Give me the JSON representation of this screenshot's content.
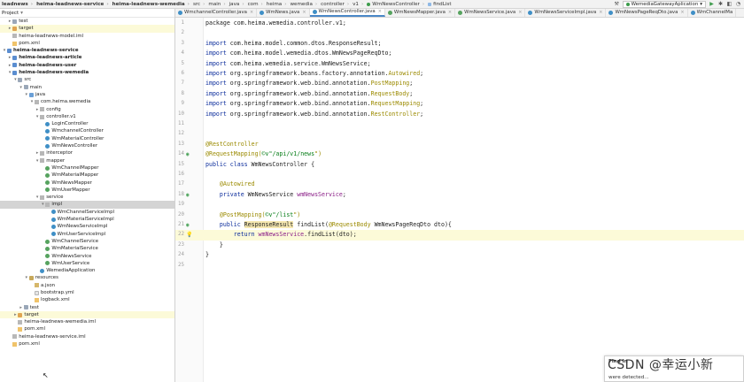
{
  "breadcrumb": {
    "items": [
      "leadnews",
      "heima-leadnews-service",
      "heima-leadnews-wemedia",
      "src",
      "main",
      "java",
      "com",
      "heima",
      "wemedia",
      "controller",
      "v1",
      "WmNewsController",
      "findList"
    ],
    "bold_count": 3
  },
  "toolbar": {
    "run_config": "WemediaGatewayAplication",
    "run_icon": "play-icon",
    "debug_icon": "bug-icon"
  },
  "project": {
    "title": "Project",
    "tree": [
      {
        "label": "test",
        "depth": 1,
        "kind": "folder",
        "arrow": "▸"
      },
      {
        "label": "target",
        "depth": 1,
        "kind": "folder-target",
        "arrow": "▸",
        "hl": true
      },
      {
        "label": "heima-leadnews-model.iml",
        "depth": 1,
        "kind": "iml"
      },
      {
        "label": "pom.xml",
        "depth": 1,
        "kind": "xml"
      },
      {
        "label": "heima-leadnews-service",
        "depth": 0,
        "kind": "module",
        "arrow": "▾",
        "bold": true
      },
      {
        "label": "heima-leadnews-article",
        "depth": 1,
        "kind": "module",
        "arrow": "▸",
        "bold": true
      },
      {
        "label": "heima-leadnews-user",
        "depth": 1,
        "kind": "module",
        "arrow": "▸",
        "bold": true
      },
      {
        "label": "heima-leadnews-wemedia",
        "depth": 1,
        "kind": "module",
        "arrow": "▾",
        "bold": true
      },
      {
        "label": "src",
        "depth": 2,
        "kind": "folder",
        "arrow": "▾"
      },
      {
        "label": "main",
        "depth": 3,
        "kind": "folder",
        "arrow": "▾"
      },
      {
        "label": "java",
        "depth": 4,
        "kind": "folder-src",
        "arrow": "▾"
      },
      {
        "label": "com.heima.wemedia",
        "depth": 5,
        "kind": "pkg",
        "arrow": "▾"
      },
      {
        "label": "config",
        "depth": 6,
        "kind": "pkg",
        "arrow": "▸"
      },
      {
        "label": "controller.v1",
        "depth": 6,
        "kind": "pkg",
        "arrow": "▾"
      },
      {
        "label": "LoginController",
        "depth": 7,
        "kind": "class"
      },
      {
        "label": "WmchannelController",
        "depth": 7,
        "kind": "class"
      },
      {
        "label": "WmMaterialController",
        "depth": 7,
        "kind": "class"
      },
      {
        "label": "WmNewsController",
        "depth": 7,
        "kind": "class"
      },
      {
        "label": "interceptor",
        "depth": 6,
        "kind": "pkg",
        "arrow": "▸"
      },
      {
        "label": "mapper",
        "depth": 6,
        "kind": "pkg",
        "arrow": "▾"
      },
      {
        "label": "WmChannelMapper",
        "depth": 7,
        "kind": "iface"
      },
      {
        "label": "WmMaterialMapper",
        "depth": 7,
        "kind": "iface"
      },
      {
        "label": "WmNewsMapper",
        "depth": 7,
        "kind": "iface"
      },
      {
        "label": "WmUserMapper",
        "depth": 7,
        "kind": "iface"
      },
      {
        "label": "service",
        "depth": 6,
        "kind": "pkg",
        "arrow": "▾"
      },
      {
        "label": "impl",
        "depth": 7,
        "kind": "pkg",
        "arrow": "▾",
        "sel": true
      },
      {
        "label": "WmChannelServiceImpl",
        "depth": 8,
        "kind": "class"
      },
      {
        "label": "WmMaterialServiceImpl",
        "depth": 8,
        "kind": "class"
      },
      {
        "label": "WmNewsServiceImpl",
        "depth": 8,
        "kind": "class"
      },
      {
        "label": "WmUserServiceImpl",
        "depth": 8,
        "kind": "class"
      },
      {
        "label": "WmChannelService",
        "depth": 7,
        "kind": "iface"
      },
      {
        "label": "WmMaterialService",
        "depth": 7,
        "kind": "iface"
      },
      {
        "label": "WmNewsService",
        "depth": 7,
        "kind": "iface"
      },
      {
        "label": "WmUserService",
        "depth": 7,
        "kind": "iface"
      },
      {
        "label": "WemediaApplication",
        "depth": 6,
        "kind": "class"
      },
      {
        "label": "resources",
        "depth": 4,
        "kind": "folder-res",
        "arrow": "▾"
      },
      {
        "label": "a.json",
        "depth": 5,
        "kind": "json"
      },
      {
        "label": "bootstrap.yml",
        "depth": 5,
        "kind": "file"
      },
      {
        "label": "logback.xml",
        "depth": 5,
        "kind": "xml"
      },
      {
        "label": "test",
        "depth": 3,
        "kind": "folder",
        "arrow": "▸"
      },
      {
        "label": "target",
        "depth": 2,
        "kind": "folder-target",
        "arrow": "▸",
        "hl": true
      },
      {
        "label": "heima-leadnews-wemedia.iml",
        "depth": 2,
        "kind": "iml"
      },
      {
        "label": "pom.xml",
        "depth": 2,
        "kind": "xml"
      },
      {
        "label": "heima-leadnews-service.iml",
        "depth": 1,
        "kind": "iml"
      },
      {
        "label": "pom.xml",
        "depth": 1,
        "kind": "xml"
      }
    ]
  },
  "tabs": [
    {
      "label": "WmchannelController.java",
      "kind": "class"
    },
    {
      "label": "WmNews.java",
      "kind": "class"
    },
    {
      "label": "WmNewsController.java",
      "kind": "class",
      "active": true
    },
    {
      "label": "WmNewsMapper.java",
      "kind": "iface"
    },
    {
      "label": "WmNewsService.java",
      "kind": "iface"
    },
    {
      "label": "WmNewsServiceImpl.java",
      "kind": "class"
    },
    {
      "label": "WmNewsPageReqDto.java",
      "kind": "class"
    },
    {
      "label": "WmChannelMa",
      "kind": "class"
    }
  ],
  "editor": {
    "lines": [
      [
        {
          "t": "package com.heima.wemedia.controller.v1;",
          "c": ""
        }
      ],
      [],
      [
        {
          "t": "import ",
          "c": "kw"
        },
        {
          "t": "com.heima.model.common.dtos.ResponseResult;",
          "c": ""
        }
      ],
      [
        {
          "t": "import ",
          "c": "kw"
        },
        {
          "t": "com.heima.model.wemedia.dtos.WmNewsPageReqDto;",
          "c": ""
        }
      ],
      [
        {
          "t": "import ",
          "c": "kw"
        },
        {
          "t": "com.heima.wemedia.service.WmNewsService;",
          "c": ""
        }
      ],
      [
        {
          "t": "import ",
          "c": "kw"
        },
        {
          "t": "org.springframework.beans.factory.annotation.",
          "c": ""
        },
        {
          "t": "Autowired",
          "c": "ann"
        },
        {
          "t": ";",
          "c": ""
        }
      ],
      [
        {
          "t": "import ",
          "c": "kw"
        },
        {
          "t": "org.springframework.web.bind.annotation.",
          "c": ""
        },
        {
          "t": "PostMapping",
          "c": "ann"
        },
        {
          "t": ";",
          "c": ""
        }
      ],
      [
        {
          "t": "import ",
          "c": "kw"
        },
        {
          "t": "org.springframework.web.bind.annotation.",
          "c": ""
        },
        {
          "t": "RequestBody",
          "c": "ann"
        },
        {
          "t": ";",
          "c": ""
        }
      ],
      [
        {
          "t": "import ",
          "c": "kw"
        },
        {
          "t": "org.springframework.web.bind.annotation.",
          "c": ""
        },
        {
          "t": "RequestMapping",
          "c": "ann"
        },
        {
          "t": ";",
          "c": ""
        }
      ],
      [
        {
          "t": "import ",
          "c": "kw"
        },
        {
          "t": "org.springframework.web.bind.annotation.",
          "c": ""
        },
        {
          "t": "RestController",
          "c": "ann"
        },
        {
          "t": ";",
          "c": ""
        }
      ],
      [],
      [],
      [
        {
          "t": "@RestController",
          "c": "ann"
        }
      ],
      [
        {
          "t": "@RequestMapping(",
          "c": "ann"
        },
        {
          "t": "©∨\"",
          "c": "str"
        },
        {
          "t": "/api/v1/news",
          "c": "str"
        },
        {
          "t": "\")",
          "c": "ann"
        }
      ],
      [
        {
          "t": "public class ",
          "c": "kw"
        },
        {
          "t": "WmNewsController {",
          "c": ""
        }
      ],
      [],
      [
        {
          "t": "    @Autowired",
          "c": "ann"
        }
      ],
      [
        {
          "t": "    private ",
          "c": "kw"
        },
        {
          "t": "WmNewsService ",
          "c": ""
        },
        {
          "t": "wmNewsService",
          "c": "fld"
        },
        {
          "t": ";",
          "c": ""
        }
      ],
      [],
      [
        {
          "t": "    @PostMapping(",
          "c": "ann"
        },
        {
          "t": "©∨\"",
          "c": "str"
        },
        {
          "t": "/list",
          "c": "str"
        },
        {
          "t": "\")",
          "c": "ann"
        }
      ],
      [
        {
          "t": "    public ",
          "c": "kw"
        },
        {
          "t": "ResponseResult",
          "c": "hlbg"
        },
        {
          "t": " findList(",
          "c": ""
        },
        {
          "t": "@RequestBody ",
          "c": "ann"
        },
        {
          "t": "WmNewsPageReqDto dto){",
          "c": ""
        }
      ],
      [
        {
          "t": "        return ",
          "c": "kw"
        },
        {
          "t": "wmNewsService",
          "c": "fld"
        },
        {
          "t": ".findList(dto);",
          "c": ""
        }
      ],
      [
        {
          "t": "    }",
          "c": ""
        }
      ],
      [
        {
          "t": "}",
          "c": ""
        }
      ],
      []
    ],
    "current_line": 22,
    "gutter_icons": {
      "14": "bean-icon",
      "18": "bean-icon",
      "21": "bean-icon",
      "22": "lightbulb-icon"
    }
  },
  "notification": {
    "title": "Find In",
    "body": "were detected..."
  },
  "watermark": "CSDN @幸运小新",
  "colors": {
    "keyword": "#0a2b9b",
    "annotation": "#9b8a00",
    "string": "#067d17",
    "field": "#8a1d87",
    "active_tab_underline": "#4a88c7",
    "selection": "#d4d4d4",
    "current_line": "#fcfad8"
  }
}
